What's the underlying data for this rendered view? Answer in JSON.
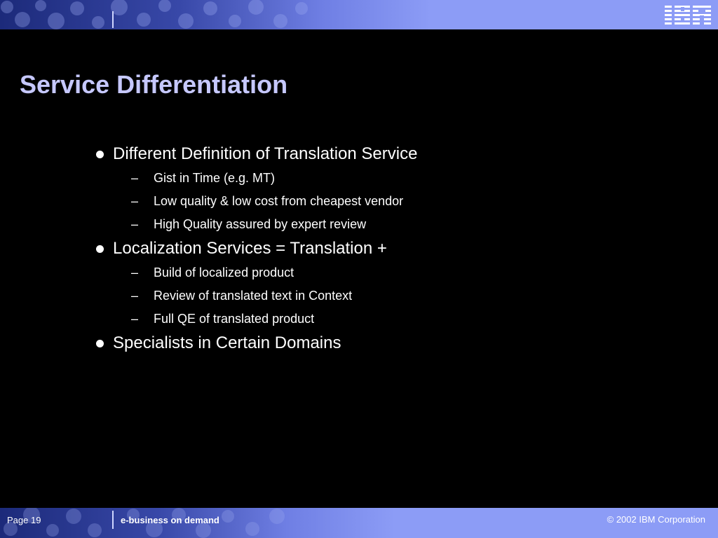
{
  "header": {
    "logo_text": "IBM"
  },
  "slide": {
    "title": "Service Differentiation",
    "bullets": [
      {
        "text": "Different Definition of Translation Service",
        "subitems": [
          "Gist in Time (e.g. MT)",
          "Low quality & low cost from cheapest vendor",
          "High Quality assured by expert review"
        ]
      },
      {
        "text": "Localization Services = Translation +",
        "subitems": [
          "Build of localized product",
          "Review of translated text  in Context",
          "Full QE of translated product"
        ]
      },
      {
        "text": "Specialists in Certain Domains",
        "subitems": []
      }
    ],
    "sub_marker": "–"
  },
  "footer": {
    "page_label": "Page 19",
    "tagline": "e-business on demand",
    "copyright": "© 2002 IBM Corporation"
  },
  "colors": {
    "background": "#000000",
    "title": "#c6c8ff",
    "banner": "#8c9cf6",
    "text": "#ffffff"
  }
}
